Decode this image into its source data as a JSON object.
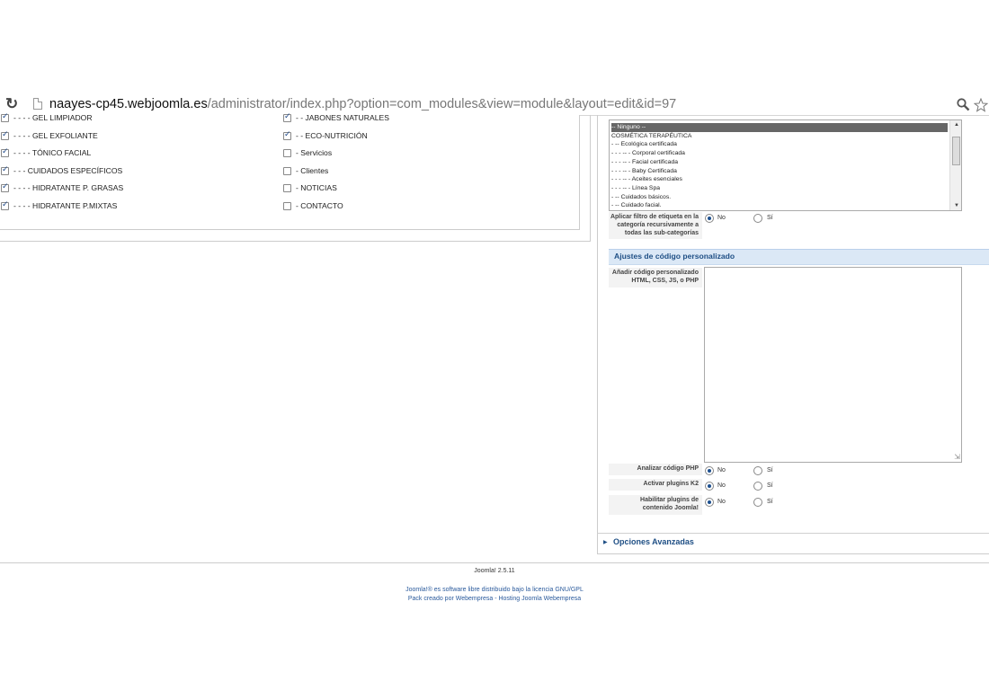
{
  "browser": {
    "url_domain": "naayes-cp45.webjoomla.es",
    "url_path": "/administrator/index.php?option=com_modules&view=module&layout=edit&id=97"
  },
  "categories_left": [
    {
      "label": "- - - - GEL LIMPIADOR",
      "checked": true
    },
    {
      "label": "- - - - GEL EXFOLIANTE",
      "checked": true
    },
    {
      "label": "- - - - TÓNICO FACIAL",
      "checked": true
    },
    {
      "label": "- - - CUIDADOS ESPECÍFICOS",
      "checked": true
    },
    {
      "label": "- - - - HIDRATANTE P. GRASAS",
      "checked": true
    },
    {
      "label": "- - - - HIDRATANTE P.MIXTAS",
      "checked": true
    }
  ],
  "categories_right": [
    {
      "label": "- - JABONES NATURALES",
      "checked": true
    },
    {
      "label": "- - ECO-NUTRICIÓN",
      "checked": true
    },
    {
      "label": "- Servicios",
      "checked": false
    },
    {
      "label": "- Clientes",
      "checked": false
    },
    {
      "label": "- NOTICIAS",
      "checked": false
    },
    {
      "label": "- CONTACTO",
      "checked": false
    }
  ],
  "category_select": {
    "options": [
      "-- Ninguno --",
      "COSMÉTICA TERAPÉUTICA",
      "- -- Ecológica certificada",
      "- - - -- - Corporal certificada",
      "- - - -- - Facial certificada",
      "- - - -- - Baby Certificada",
      "- - - -- - Aceites esenciales",
      "- - - -- - Línea Spa",
      "- -- Cuidados básicos.",
      "- -- Cuidado facial."
    ],
    "selected_index": 0
  },
  "recursive_filter": {
    "label": "Aplicar filtro de etiqueta en la categoría recursivamente a todas las sub-categorías",
    "no": "No",
    "yes": "Sí",
    "value": "No"
  },
  "custom_code_section": {
    "title": "Ajustes de código personalizado",
    "code_label": "Añadir código personalizado HTML, CSS, JS, o PHP",
    "code_value": ""
  },
  "radio_settings": [
    {
      "label": "Analizar código PHP",
      "no": "No",
      "yes": "Sí",
      "value": "No"
    },
    {
      "label": "Activar plugins K2",
      "no": "No",
      "yes": "Sí",
      "value": "No"
    },
    {
      "label": "Habilitar plugins de contenido Joomla!",
      "no": "No",
      "yes": "Sí",
      "value": "No"
    }
  ],
  "advanced_options": "Opciones Avanzadas",
  "footer": {
    "version": "Joomla! 2.5.11",
    "license": "Joomla!® es software libre distribuido bajo la licencia GNU/GPL",
    "credit": "Pack creado por Webempresa - Hosting Joomla Webempresa"
  },
  "colors": {
    "accent": "#1f4f85",
    "section_bg": "#dbe8f6"
  }
}
